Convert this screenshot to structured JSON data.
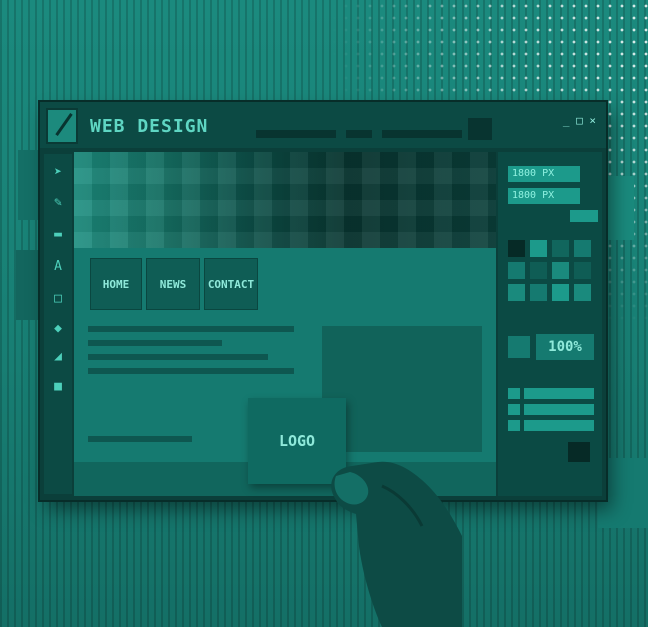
{
  "app": {
    "title": "WEB DESIGN",
    "window_controls": "_ □ ×"
  },
  "mockup": {
    "nav": [
      "HOME",
      "NEWS",
      "CONTACT"
    ],
    "logo_text": "LOGO"
  },
  "panel": {
    "sizes": [
      "1800 PX",
      "1800 PX"
    ],
    "zoom": "100%"
  },
  "colors": {
    "background": "#1b8a7e",
    "frame": "#0b3f3a",
    "accent": "#5fd6c3"
  },
  "tools": [
    "pointer-icon",
    "brush-icon",
    "rectangle-icon",
    "text-icon",
    "frame-icon",
    "fill-icon",
    "eraser-icon",
    "color-icon"
  ]
}
